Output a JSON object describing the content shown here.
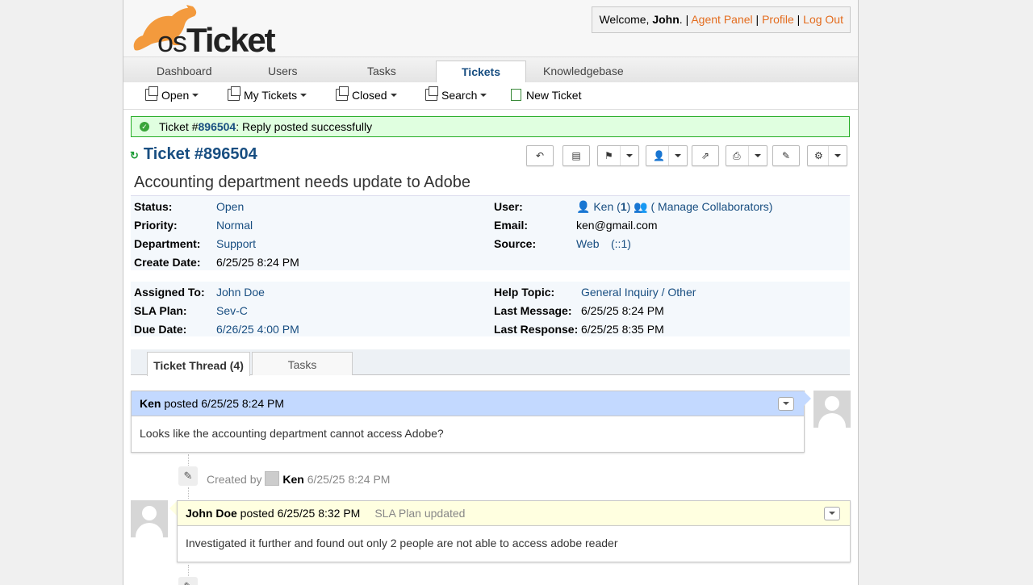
{
  "header": {
    "logo": "osTicket",
    "welcome_prefix": "Welcome, ",
    "user_name": "John",
    "welcome_suffix": ".",
    "links": [
      "Agent Panel",
      "Profile",
      "Log Out"
    ],
    "sep": " | "
  },
  "nav": {
    "tabs": [
      "Dashboard",
      "Users",
      "Tasks",
      "Tickets",
      "Knowledgebase"
    ],
    "active": "Tickets"
  },
  "subnav": {
    "items": [
      "Open",
      "My Tickets",
      "Closed",
      "Search",
      "New Ticket"
    ]
  },
  "notice": {
    "prefix": "Ticket #",
    "number": "896504",
    "text": ": Reply posted successfully"
  },
  "ticket": {
    "title": "Ticket #896504",
    "subject": "Accounting department needs update to Adobe"
  },
  "info": {
    "status_label": "Status:",
    "status": "Open",
    "priority_label": "Priority:",
    "priority": "Normal",
    "department_label": "Department:",
    "department": "Support",
    "create_label": "Create Date:",
    "create": "6/25/25 8:24 PM",
    "user_label": "User:",
    "user": "Ken",
    "user_count_open": " (",
    "user_count": "1",
    "user_count_close": ")",
    "collab": "( Manage Collaborators)",
    "email_label": "Email:",
    "email": "ken@gmail.com",
    "source_label": "Source:",
    "source": "Web",
    "source_ip": "(::1)",
    "assigned_label": "Assigned To:",
    "assigned": "John Doe",
    "sla_label": "SLA Plan:",
    "sla": "Sev-C",
    "due_label": "Due Date:",
    "due": "6/26/25 4:00 PM",
    "topic_label": "Help Topic:",
    "topic": "General Inquiry / Other",
    "last_msg_label": "Last Message:",
    "last_msg": "6/25/25 8:24 PM",
    "last_resp_label": "Last Response:",
    "last_resp": "6/25/25 8:35 PM"
  },
  "thread_tabs": [
    "Ticket Thread (4)",
    "Tasks"
  ],
  "thread": {
    "entry1": {
      "author": "Ken",
      "posted": " posted 6/25/25 8:24 PM",
      "body": "Looks like the accounting department cannot access Adobe?"
    },
    "event1": {
      "prefix": "Created by",
      "who": "Ken",
      "time": "6/25/25 8:24 PM"
    },
    "entry2": {
      "author": "John Doe",
      "posted": " posted 6/25/25 8:32 PM",
      "note": "SLA Plan updated",
      "body": "Investigated it further and found out only 2 people are not able to access adobe reader"
    }
  },
  "colors": {
    "accent": "#184E81",
    "orange": "#E36C1E",
    "success_bg": "#e0ffe0",
    "success_border": "#27ae27",
    "message_head": "#c3d9ff",
    "response_head": "#ffffe0"
  }
}
